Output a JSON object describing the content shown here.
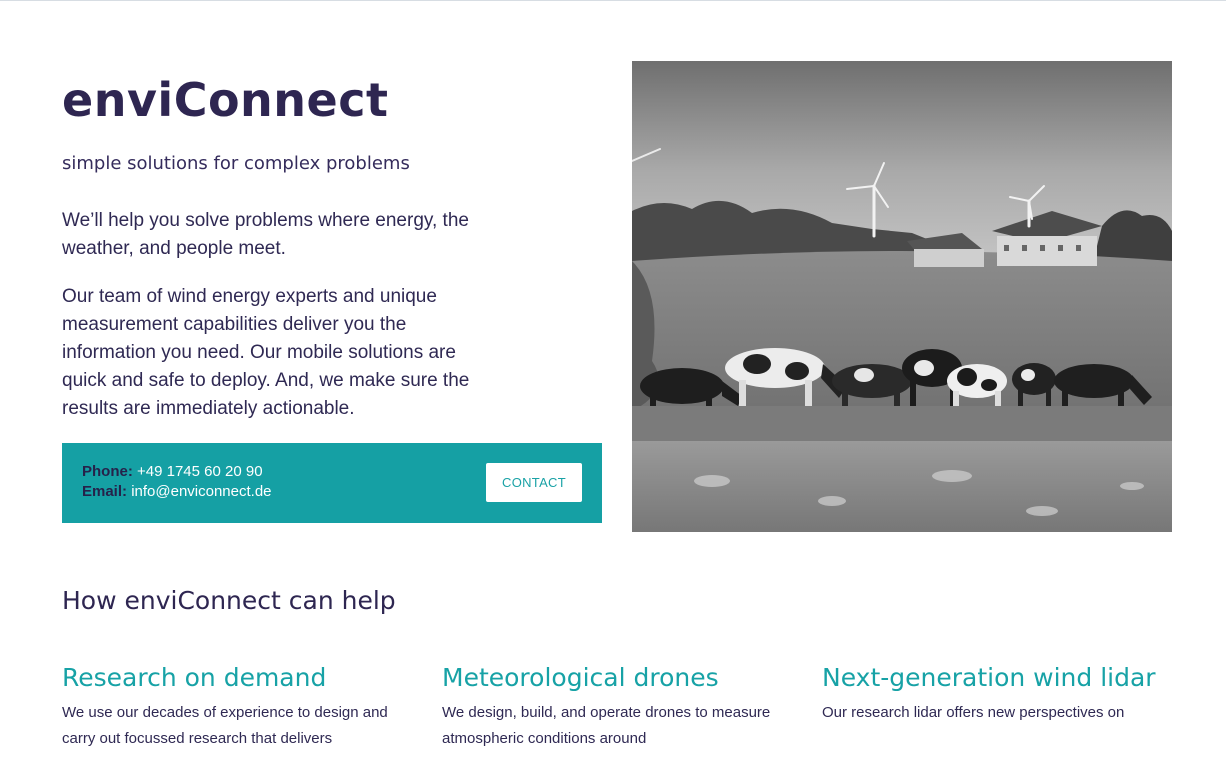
{
  "brand": {
    "title": "enviConnect",
    "tagline": "simple solutions for complex problems"
  },
  "intro": {
    "paragraph_1": "We’ll help you solve problems where energy, the weather, and people meet.",
    "paragraph_2": "Our team of wind energy experts and unique measurement capabilities deliver you the information you need. Our mobile solutions are quick and safe to deploy. And, we make sure the results are immediately actionable."
  },
  "contact": {
    "phone_label": "Phone:",
    "phone_value": "+49 1745 60 20 90",
    "email_label": "Email:",
    "email_value": "info@enviconnect.de",
    "button_label": "CONTACT"
  },
  "hero_image": {
    "subject": "cows grazing in a meadow with wind turbines and farm buildings",
    "style": "black-and-white photo"
  },
  "services_section": {
    "title": "How enviConnect can help",
    "items": [
      {
        "title": "Research on demand",
        "text": "We use our decades of experience to design and carry out focussed research that delivers"
      },
      {
        "title": "Meteorological drones",
        "text": "We design, build, and operate drones to measure atmospheric conditions around"
      },
      {
        "title": "Next-generation wind lidar",
        "text": "Our research lidar offers new perspectives on"
      }
    ]
  },
  "colors": {
    "brand_dark": "#2e2651",
    "accent_teal": "#15a0a4",
    "white": "#ffffff"
  }
}
